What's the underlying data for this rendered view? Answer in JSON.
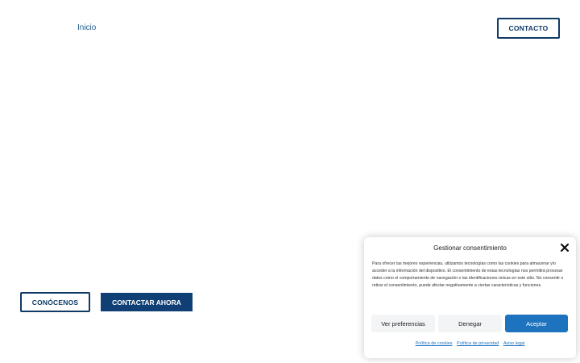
{
  "header": {
    "nav_home": "Inicio",
    "contact_button": "CONTACTO"
  },
  "hero": {
    "about_button": "CONÓCENOS",
    "contact_now_button": "CONTACTAR AHORA"
  },
  "consent": {
    "title": "Gestionar consentimiento",
    "close_icon": "close-icon",
    "body": "Para ofrecer las mejores experiencias, utilizamos tecnologías como las cookies para almacenar y/o acceder a la información del dispositivo. El consentimiento de estas tecnologías nos permitirá procesar datos como el comportamiento de navegación o las identificaciones únicas en este sitio. No consentir o retirar el consentimiento, puede afectar negativamente a ciertas características y funciones.",
    "preferences_label": "Ver preferencias",
    "deny_label": "Denegar",
    "accept_label": "Aceptar",
    "links": [
      "Política de cookies",
      "Política de privacidad",
      "Aviso legal"
    ]
  },
  "colors": {
    "brand_dark": "#0f3f75",
    "accept_blue": "#1e73be",
    "nav_link": "#1d5a8c"
  }
}
